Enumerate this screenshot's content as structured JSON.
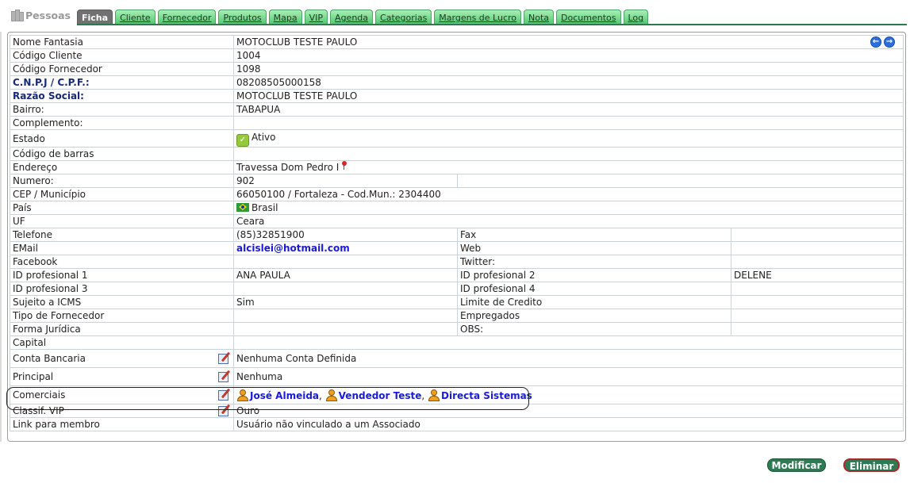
{
  "header": {
    "brand": "Pessoas",
    "tabs": [
      "Ficha",
      "Cliente",
      "Fornecedor",
      "Produtos",
      "Mapa",
      "VIP",
      "Agenda",
      "Categorias",
      "Margens de Lucro",
      "Nota",
      "Documentos",
      "Log"
    ],
    "active_tab": "Ficha"
  },
  "ficha": {
    "nome_fantasia": {
      "label": "Nome Fantasia",
      "value": "MOTOCLUB TESTE PAULO"
    },
    "codigo_cliente": {
      "label": "Código Cliente",
      "value": "1004"
    },
    "codigo_fornecedor": {
      "label": "Código Fornecedor",
      "value": "1098"
    },
    "cnpj": {
      "label": "C.N.P.J / C.P.F.:",
      "value": "08208505000158"
    },
    "razao_social": {
      "label": "Razão Social:",
      "value": "MOTOCLUB TESTE PAULO"
    },
    "bairro": {
      "label": "Bairro:",
      "value": "TABAPUA"
    },
    "complemento": {
      "label": "Complemento:",
      "value": ""
    },
    "estado": {
      "label": "Estado",
      "value": "Ativo"
    },
    "codigo_barras": {
      "label": "Código de barras",
      "value": ""
    },
    "endereco": {
      "label": "Endereço",
      "value": "Travessa Dom Pedro I"
    },
    "numero": {
      "label": "Numero:",
      "value": "902"
    },
    "cep_municipio": {
      "label": "CEP / Município",
      "value": "66050100 / Fortaleza - Cod.Mun.: 2304400"
    },
    "pais": {
      "label": "País",
      "value": "Brasil"
    },
    "uf": {
      "label": "UF",
      "value": "Ceara"
    },
    "telefone": {
      "label": "Telefone",
      "value": "(85)32851900"
    },
    "fax": {
      "label": "Fax",
      "value": ""
    },
    "email": {
      "label": "EMail",
      "value": "alcislei@hotmail.com"
    },
    "web": {
      "label": "Web",
      "value": ""
    },
    "facebook": {
      "label": "Facebook",
      "value": ""
    },
    "twitter": {
      "label": "Twitter:",
      "value": ""
    },
    "id_prof_1": {
      "label": "ID profesional 1",
      "value": "ANA PAULA"
    },
    "id_prof_2": {
      "label": "ID profesional 2",
      "value": "DELENE"
    },
    "id_prof_3": {
      "label": "ID profesional 3",
      "value": ""
    },
    "id_prof_4": {
      "label": "ID profesional 4",
      "value": ""
    },
    "sujeito_icms": {
      "label": "Sujeito a ICMS",
      "value": "Sim"
    },
    "limite_credito": {
      "label": "Limite de Credito",
      "value": ""
    },
    "tipo_fornecedor": {
      "label": "Tipo de Fornecedor",
      "value": ""
    },
    "empregados": {
      "label": "Empregados",
      "value": ""
    },
    "forma_juridica": {
      "label": "Forma Jurídica",
      "value": ""
    },
    "obs": {
      "label": "OBS:",
      "value": ""
    },
    "capital": {
      "label": "Capital",
      "value": ""
    },
    "conta_bancaria": {
      "label": "Conta Bancaria",
      "value": "Nenhuma Conta Definida"
    },
    "principal": {
      "label": "Principal",
      "value": "Nenhuma"
    },
    "comerciais": {
      "label": "Comerciais",
      "people": [
        "José Almeida",
        "Vendedor Teste",
        "Directa Sistemas"
      ],
      "separator": ","
    },
    "classif_vip": {
      "label": "Classif. VIP",
      "value": "Ouro"
    },
    "link_membro": {
      "label": "Link para membro",
      "value": "Usuário não vinculado a um Associado"
    }
  },
  "actions": {
    "modify": "Modificar",
    "delete": "Eliminar"
  },
  "icons": [
    "books-icon",
    "prev-arrow-icon",
    "next-arrow-icon",
    "check-icon",
    "map-pin-icon",
    "brazil-flag-icon",
    "edit-icon",
    "person-icon"
  ],
  "colors": {
    "tab_green": "#56c874",
    "tab_active": "#717171",
    "label_strong": "#182a7a",
    "link": "#1a1adb",
    "button": "#2e7a55",
    "danger_border": "#a92a2a"
  }
}
